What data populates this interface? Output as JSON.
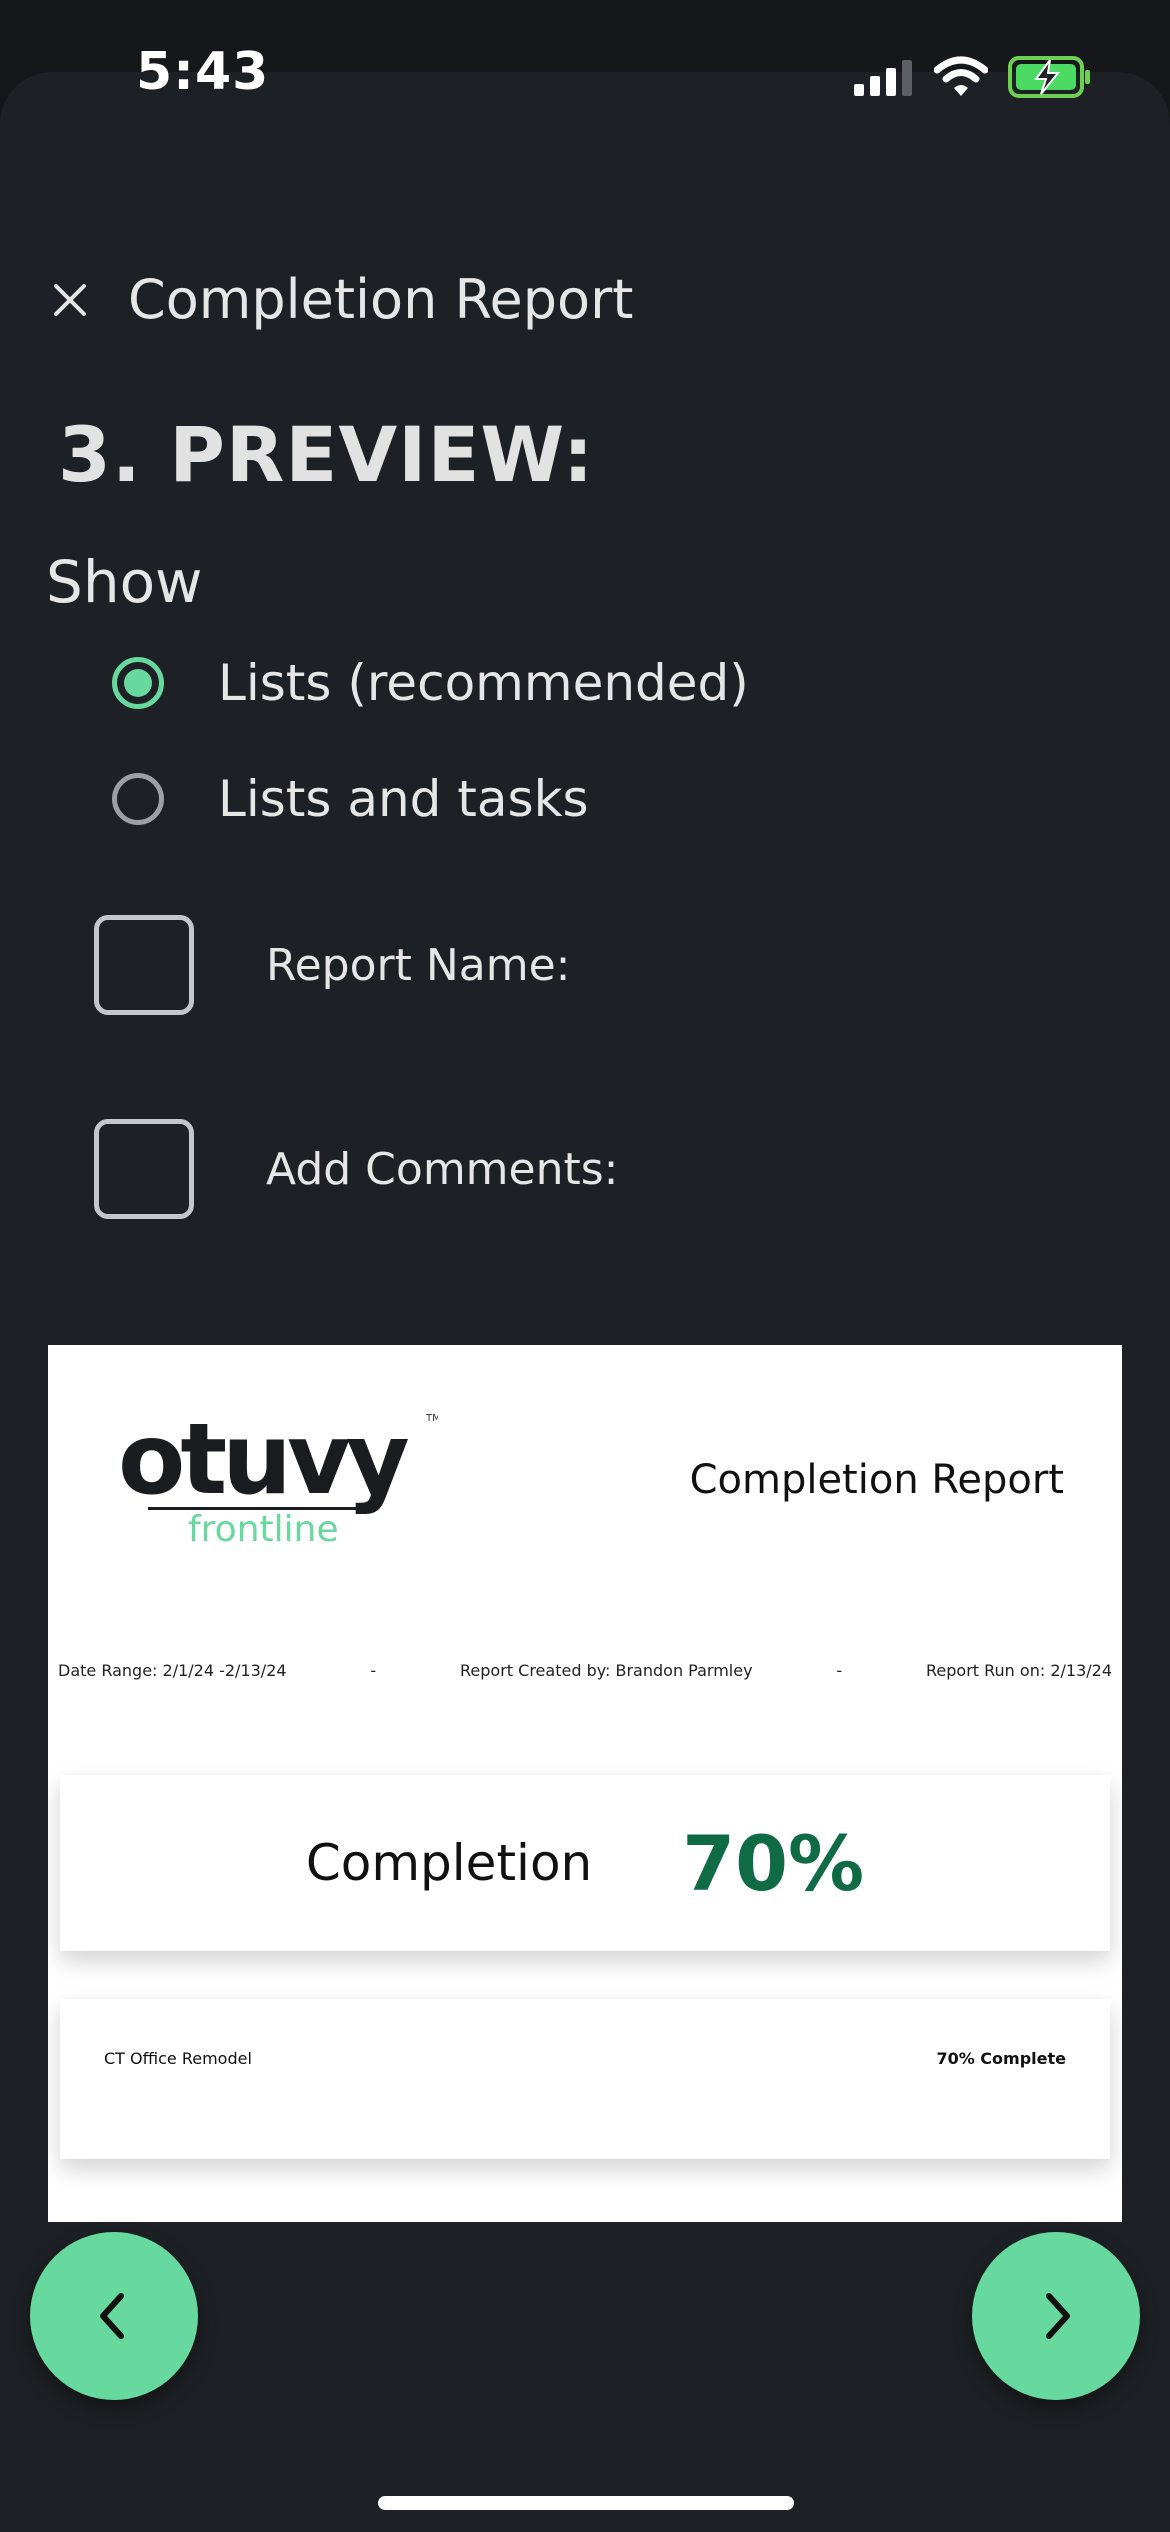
{
  "status_bar": {
    "time": "5:43"
  },
  "header": {
    "title": "Completion Report",
    "close_icon": "close-icon"
  },
  "step": {
    "heading": "3. PREVIEW:"
  },
  "show": {
    "label": "Show",
    "options": [
      {
        "label": "Lists (recommended)",
        "selected": true
      },
      {
        "label": "Lists and tasks",
        "selected": false
      }
    ]
  },
  "checkboxes": [
    {
      "label": "Report Name:",
      "checked": false
    },
    {
      "label": "Add Comments:",
      "checked": false
    }
  ],
  "preview": {
    "logo_text": "otuvy",
    "logo_sub": "frontline",
    "logo_tm": "TM",
    "title": "Completion Report",
    "date_range": "Date Range: 2/1/24 -2/13/24",
    "sep1": "-",
    "created_by": "Report Created by: Brandon Parmley",
    "sep2": "-",
    "run_on": "Report Run on: 2/13/24",
    "completion_label": "Completion",
    "completion_value": "70%",
    "list_name": "CT Office Remodel",
    "list_status": "70% Complete"
  },
  "nav": {
    "prev_icon": "chevron-left-icon",
    "next_icon": "chevron-right-icon"
  },
  "colors": {
    "accent": "#68d99e",
    "background": "#1d2024",
    "completion_green": "#0f6b45"
  }
}
